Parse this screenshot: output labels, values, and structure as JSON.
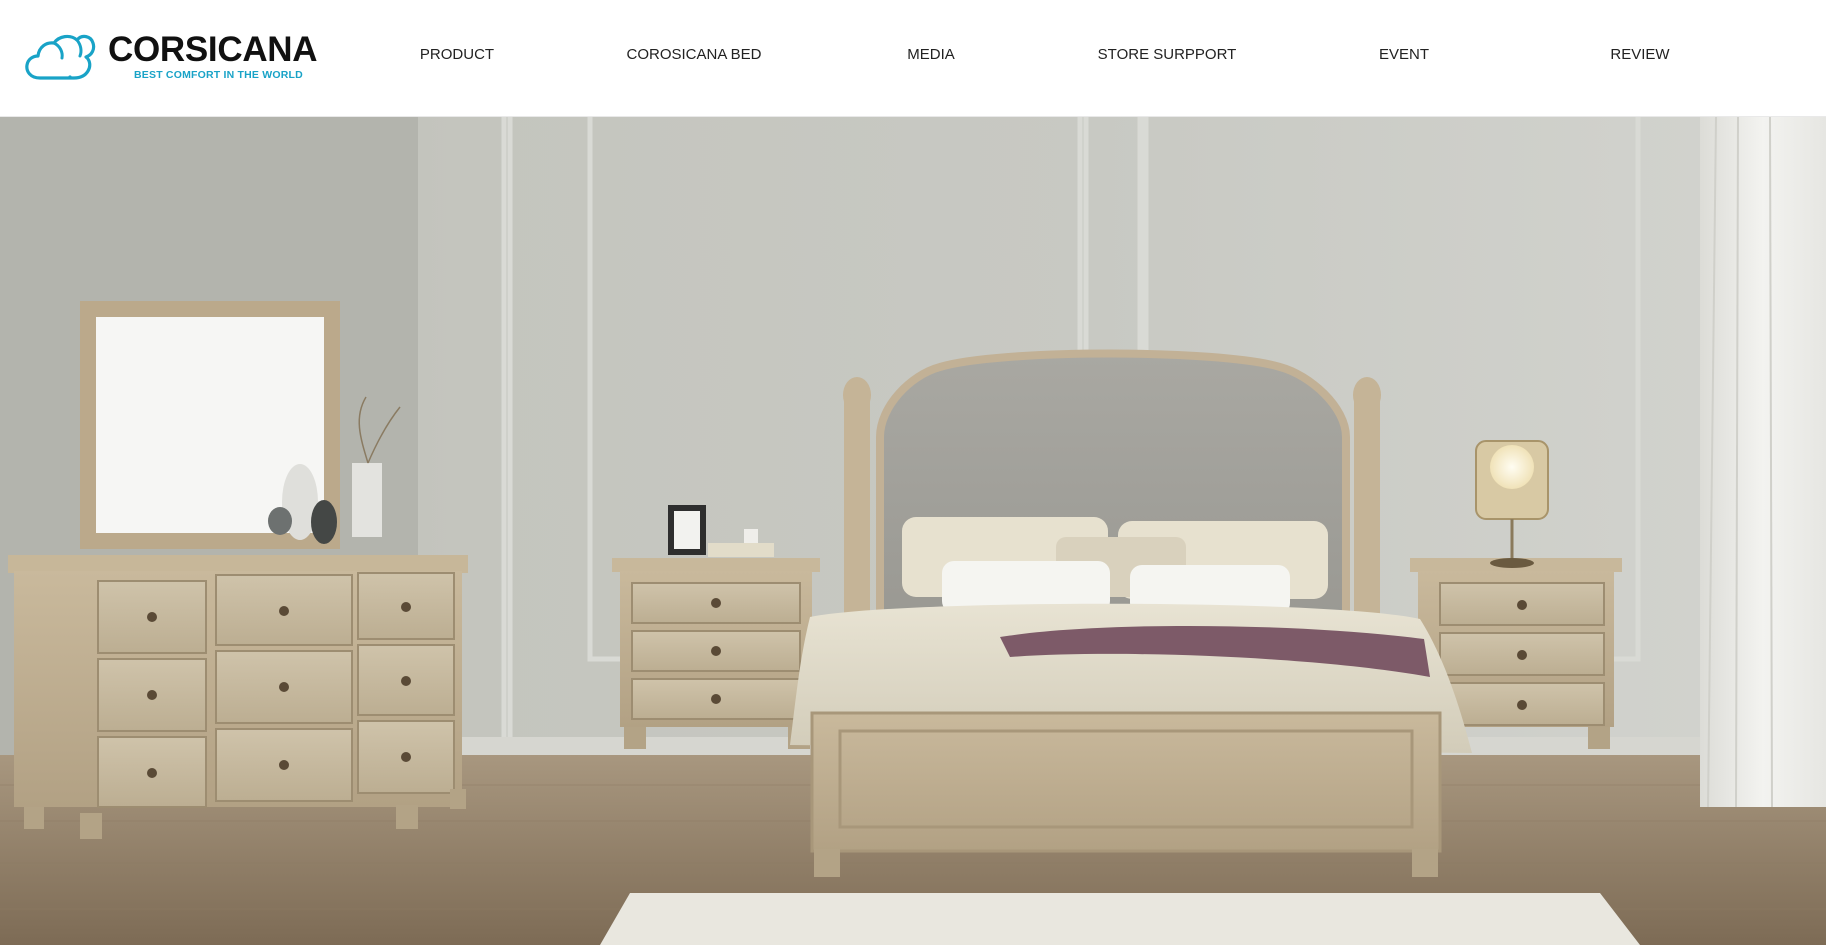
{
  "brand": {
    "name": "CORSICANA",
    "tagline": "BEST COMFORT IN THE WORLD",
    "accent_color": "#19a3c7",
    "icon": "cloud-logo-icon"
  },
  "nav": {
    "items": [
      {
        "label": "PRODUCT"
      },
      {
        "label": "COROSICANA BED"
      },
      {
        "label": "MEDIA"
      },
      {
        "label": "STORE SURPPORT"
      },
      {
        "label": "EVENT"
      },
      {
        "label": "REVIEW"
      }
    ]
  },
  "hero": {
    "image_subject": "bedroom-furniture-set"
  }
}
